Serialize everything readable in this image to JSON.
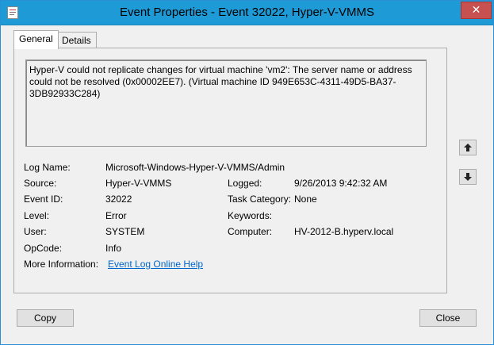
{
  "window": {
    "title": "Event Properties - Event 32022, Hyper-V-VMMS",
    "close_label": "✕"
  },
  "tabs": [
    {
      "label": "General",
      "active": true
    },
    {
      "label": "Details",
      "active": false
    }
  ],
  "description": "Hyper-V could not replicate changes for virtual machine 'vm2': The server name or address could not be resolved (0x00002EE7). (Virtual machine ID 949E653C-4311-49D5-BA37-3DB92933C284)",
  "fields": {
    "log_name": {
      "label": "Log Name:",
      "value": "Microsoft-Windows-Hyper-V-VMMS/Admin"
    },
    "source": {
      "label": "Source:",
      "value": "Hyper-V-VMMS"
    },
    "logged": {
      "label": "Logged:",
      "value": "9/26/2013 9:42:32 AM"
    },
    "event_id": {
      "label": "Event ID:",
      "value": "32022"
    },
    "task_category": {
      "label": "Task Category:",
      "value": "None"
    },
    "level": {
      "label": "Level:",
      "value": "Error"
    },
    "keywords": {
      "label": "Keywords:",
      "value": ""
    },
    "user": {
      "label": "User:",
      "value": "SYSTEM"
    },
    "computer": {
      "label": "Computer:",
      "value": "HV-2012-B.hyperv.local"
    },
    "opcode": {
      "label": "OpCode:",
      "value": "Info"
    },
    "more_info": {
      "label": "More Information:",
      "link": "Event Log Online Help"
    }
  },
  "buttons": {
    "copy": "Copy",
    "close": "Close"
  },
  "icons": {
    "window_icon": "event-viewer-icon",
    "up": "arrow-up-icon",
    "down": "arrow-down-icon"
  }
}
